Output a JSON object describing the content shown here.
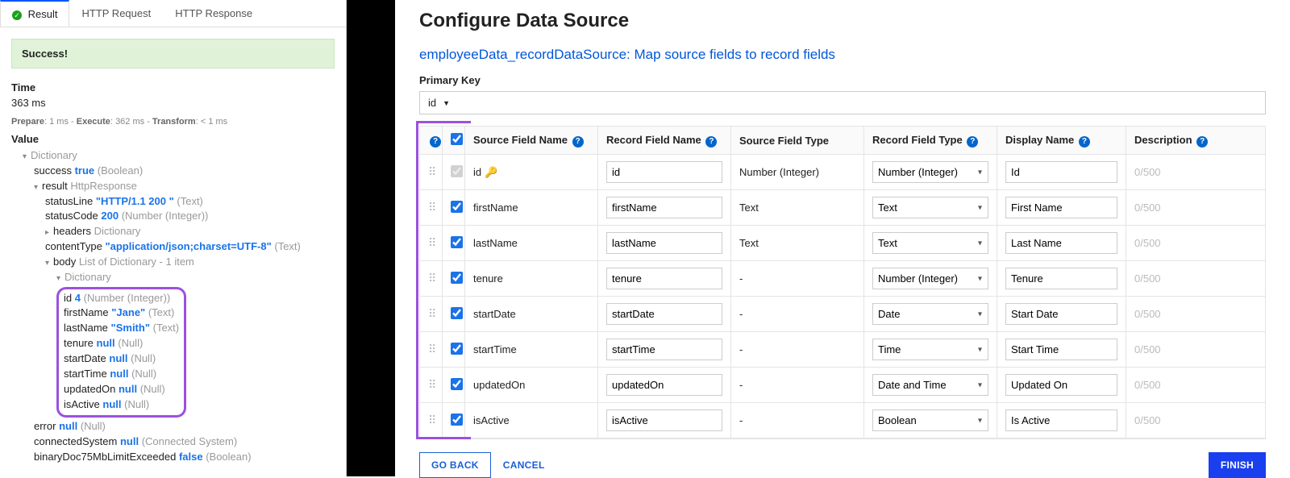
{
  "left": {
    "tabs": {
      "result": "Result",
      "request": "HTTP Request",
      "response": "HTTP Response"
    },
    "success": "Success!",
    "timeLabel": "Time",
    "timeValue": "363 ms",
    "timing": {
      "prepareLabel": "Prepare",
      "prepare": "1 ms",
      "executeLabel": "Execute",
      "execute": "362 ms",
      "transformLabel": "Transform",
      "transform": "< 1 ms"
    },
    "valueLabel": "Value",
    "tree": {
      "dictionary": "Dictionary",
      "success": {
        "key": "success",
        "val": "true",
        "type": "(Boolean)"
      },
      "result": {
        "key": "result",
        "type": "HttpResponse"
      },
      "statusLine": {
        "key": "statusLine",
        "val": "\"HTTP/1.1 200 \"",
        "type": "(Text)"
      },
      "statusCode": {
        "key": "statusCode",
        "val": "200",
        "type": "(Number (Integer))"
      },
      "headers": {
        "key": "headers",
        "type": "Dictionary"
      },
      "contentType": {
        "key": "contentType",
        "val": "\"application/json;charset=UTF-8\"",
        "type": "(Text)"
      },
      "body": {
        "key": "body",
        "type": "List of Dictionary - 1 item"
      },
      "bodyDict": "Dictionary",
      "fields": {
        "id": {
          "key": "id",
          "val": "4",
          "type": "(Number (Integer))"
        },
        "firstName": {
          "key": "firstName",
          "val": "\"Jane\"",
          "type": "(Text)"
        },
        "lastName": {
          "key": "lastName",
          "val": "\"Smith\"",
          "type": "(Text)"
        },
        "tenure": {
          "key": "tenure",
          "val": "null",
          "type": "(Null)"
        },
        "startDate": {
          "key": "startDate",
          "val": "null",
          "type": "(Null)"
        },
        "startTime": {
          "key": "startTime",
          "val": "null",
          "type": "(Null)"
        },
        "updatedOn": {
          "key": "updatedOn",
          "val": "null",
          "type": "(Null)"
        },
        "isActive": {
          "key": "isActive",
          "val": "null",
          "type": "(Null)"
        }
      },
      "error": {
        "key": "error",
        "val": "null",
        "type": "(Null)"
      },
      "connectedSystem": {
        "key": "connectedSystem",
        "val": "null",
        "type": "(Connected System)"
      },
      "binaryDoc": {
        "key": "binaryDoc75MbLimitExceeded",
        "val": "false",
        "type": "(Boolean)"
      }
    }
  },
  "right": {
    "title": "Configure Data Source",
    "subtitle": "employeeData_recordDataSource: Map source fields to record fields",
    "pkLabel": "Primary Key",
    "pkValue": "id",
    "headers": {
      "h1": "Source Field Name",
      "h2": "Record Field Name",
      "h3": "Source Field Type",
      "h4": "Record Field Type",
      "h5": "Display Name",
      "h6": "Description"
    },
    "descHint": "0/500",
    "rows": [
      {
        "source": "id",
        "record": "id",
        "srcType": "Number (Integer)",
        "recType": "Number (Integer)",
        "display": "Id",
        "key": true,
        "disabled": true
      },
      {
        "source": "firstName",
        "record": "firstName",
        "srcType": "Text",
        "recType": "Text",
        "display": "First Name"
      },
      {
        "source": "lastName",
        "record": "lastName",
        "srcType": "Text",
        "recType": "Text",
        "display": "Last Name"
      },
      {
        "source": "tenure",
        "record": "tenure",
        "srcType": "-",
        "recType": "Number (Integer)",
        "display": "Tenure"
      },
      {
        "source": "startDate",
        "record": "startDate",
        "srcType": "-",
        "recType": "Date",
        "display": "Start Date"
      },
      {
        "source": "startTime",
        "record": "startTime",
        "srcType": "-",
        "recType": "Time",
        "display": "Start Time"
      },
      {
        "source": "updatedOn",
        "record": "updatedOn",
        "srcType": "-",
        "recType": "Date and Time",
        "display": "Updated On"
      },
      {
        "source": "isActive",
        "record": "isActive",
        "srcType": "-",
        "recType": "Boolean",
        "display": "Is Active"
      }
    ],
    "buttons": {
      "goBack": "GO BACK",
      "cancel": "CANCEL",
      "finish": "FINISH"
    }
  }
}
